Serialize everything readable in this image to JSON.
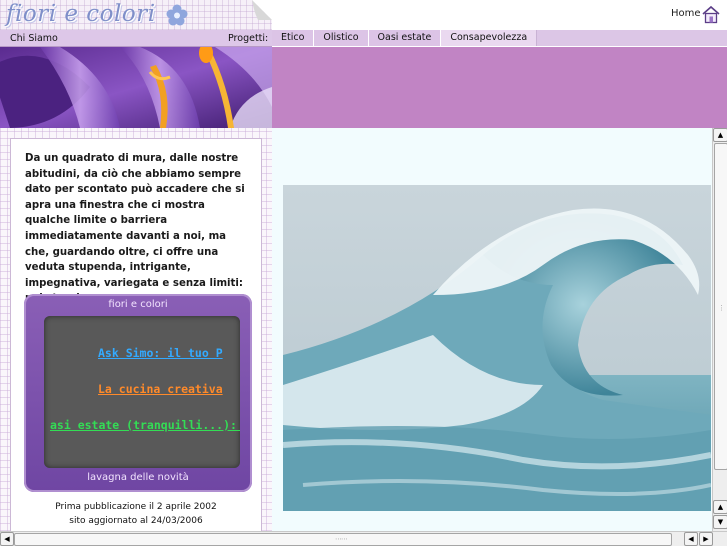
{
  "header": {
    "logo_text": "fiori e colori",
    "home_label": "Home"
  },
  "menu": {
    "chi_siamo": "Chi Siamo",
    "progetti_label": "Progetti:",
    "items": [
      {
        "label": "Etico"
      },
      {
        "label": "Olistico"
      },
      {
        "label": "Oasi estate"
      },
      {
        "label": "Consapevolezza"
      }
    ]
  },
  "sidebar": {
    "intro": "Da un quadrato di mura, dalle nostre abitudini, da ciò che abbiamo sempre dato per scontato può accadere che si apra una finestra che ci mostra qualche limite o barriera immediatamente davanti a noi, ma che, guardando oltre, ci offre una veduta stupenda, intrigante, impegnativa, variegata e senza limiti: noi stessi...",
    "news_board": {
      "title": "fiori e colori",
      "footer": "lavagna delle novità",
      "links": [
        {
          "text": "Ask Simo: il tuo P",
          "color": "#33aaff"
        },
        {
          "text": "La cucina creativa",
          "color": "#ff8a2a"
        },
        {
          "text": "asi estate (tranquilli...): v",
          "color": "#33dd55"
        }
      ]
    },
    "first_publication": "Prima pubblicazione il 2 aprile 2002",
    "last_update": "sito aggiornato al 24/03/2006"
  },
  "colors": {
    "menu_bg": "#dcc6e6",
    "banner_purple": "#c184c4",
    "main_bg": "#f2fcfe",
    "board_purple": "#7a4eaa"
  },
  "icons": {
    "home": "home-icon",
    "logo_flower": "flower-icon",
    "scroll_up": "arrow-up-icon",
    "scroll_down": "arrow-down-icon",
    "scroll_left": "arrow-left-icon",
    "scroll_right": "arrow-right-icon"
  }
}
